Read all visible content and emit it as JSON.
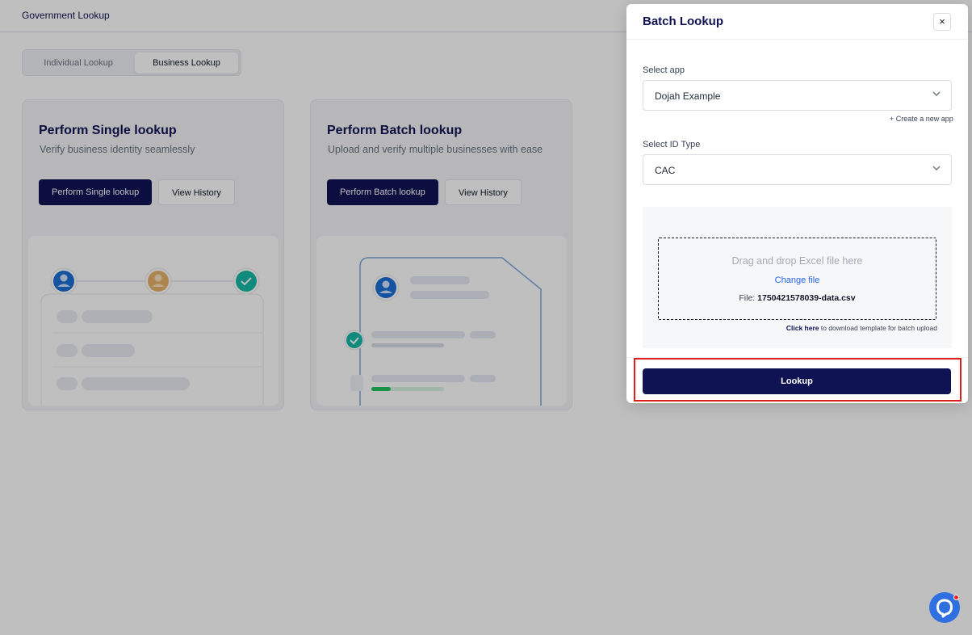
{
  "topbar": {
    "title": "Government Lookup"
  },
  "tabs": {
    "individual": "Individual Lookup",
    "business": "Business Lookup"
  },
  "cards": {
    "single": {
      "title": "Perform Single lookup",
      "subtitle": "Verify business identity seamlessly",
      "primary_button": "Perform Single lookup",
      "secondary_button": "View History"
    },
    "batch": {
      "title": "Perform Batch lookup",
      "subtitle": "Upload and verify multiple businesses with ease",
      "primary_button": "Perform Batch lookup",
      "secondary_button": "View History"
    }
  },
  "drawer": {
    "title": "Batch Lookup",
    "close_label": "×",
    "app_label": "Select app",
    "app_value": "Dojah Example",
    "create_app": "+ Create a new app",
    "id_type_label": "Select ID Type",
    "id_type_value": "CAC",
    "upload": {
      "drop_text": "Drag and drop Excel file here",
      "change_file": "Change file",
      "file_prefix": "File:",
      "file_name": "1750421578039-data.csv",
      "template_link": "Click here",
      "template_text": " to download template for batch upload"
    },
    "lookup_button": "Lookup"
  },
  "colors": {
    "brand_navy": "#0f1354",
    "link_blue": "#2563eb",
    "highlight_red": "#e11d1d",
    "chat_blue": "#2f6fe0",
    "success_teal": "#14b8a6",
    "progress_green": "#22c55e"
  },
  "icons": {
    "close": "close-icon",
    "chevron": "chevron-down-icon",
    "chat": "chat-support-icon",
    "user": "user-icon",
    "check": "check-icon"
  }
}
